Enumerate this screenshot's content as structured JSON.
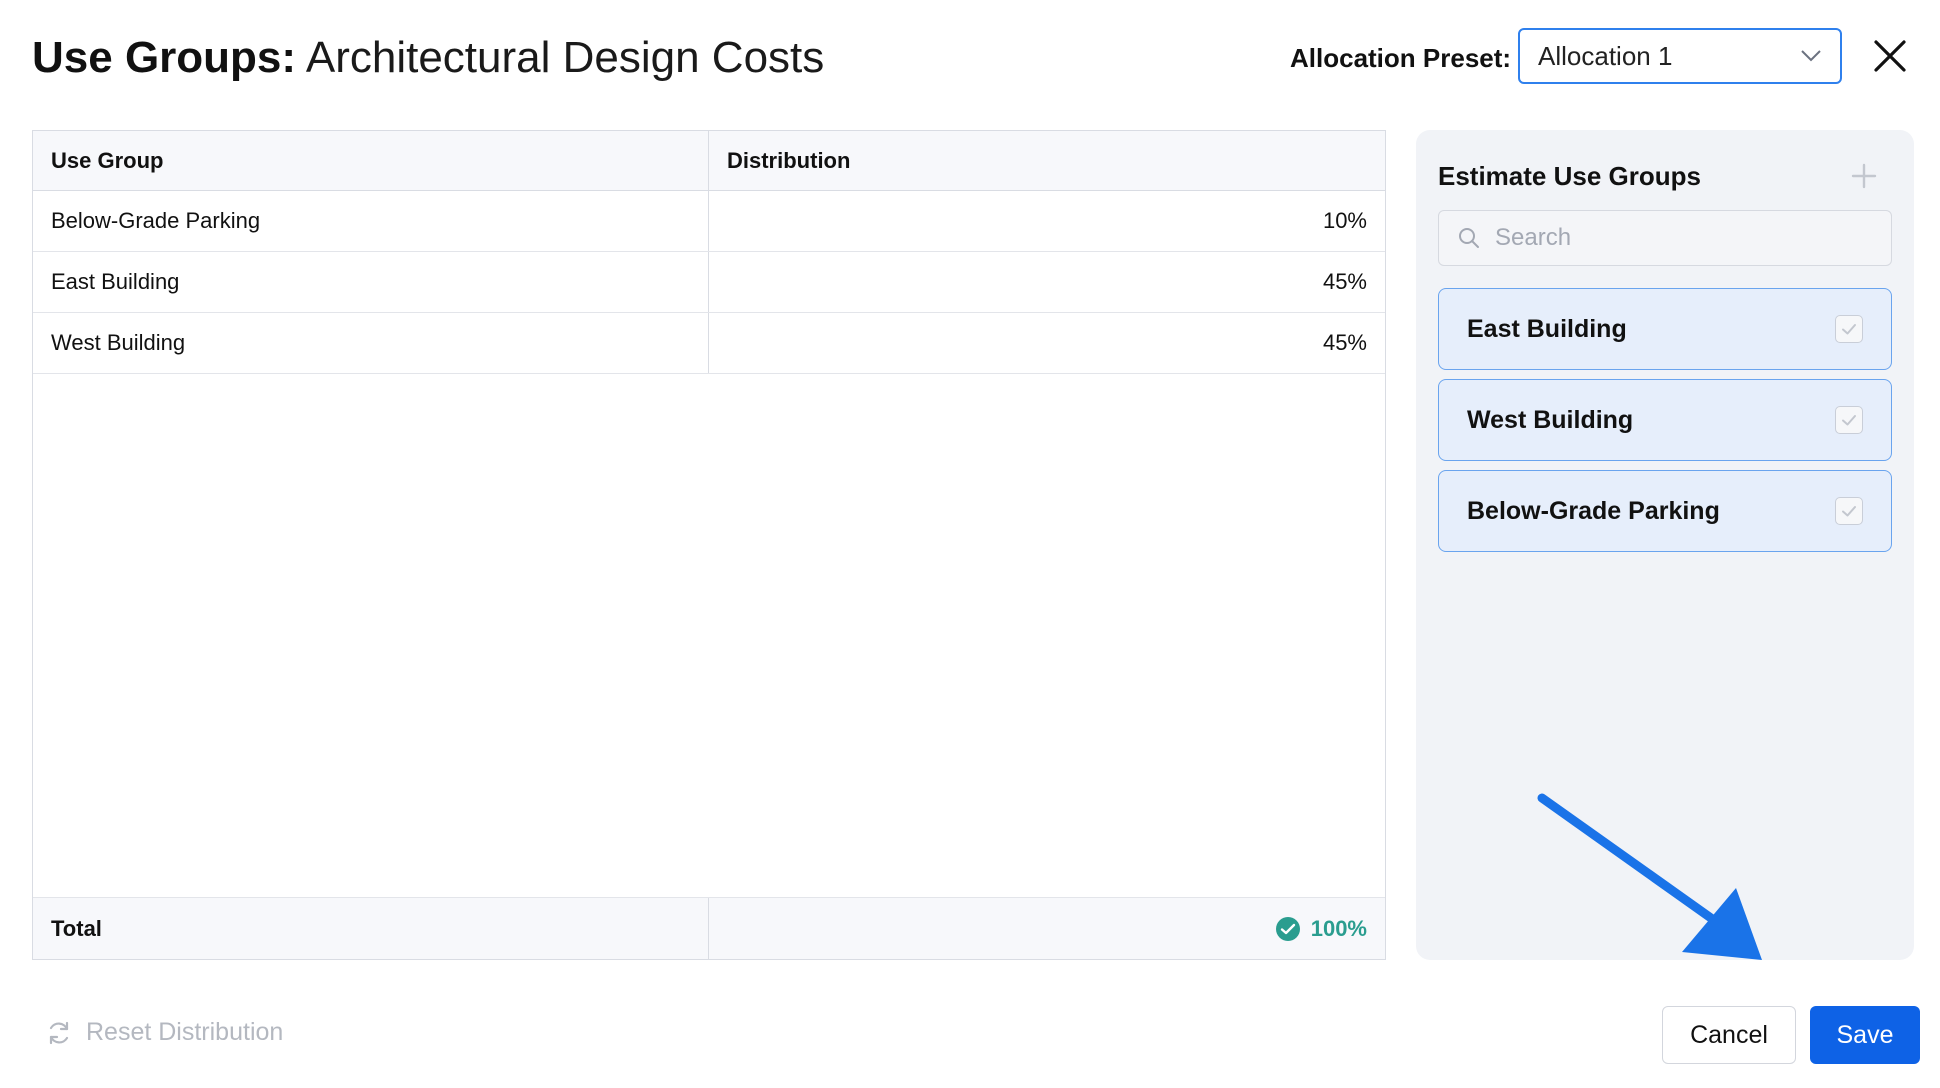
{
  "header": {
    "title_strong": "Use Groups:",
    "title_rest": "Architectural Design Costs",
    "preset_label": "Allocation Preset:",
    "preset_value": "Allocation 1"
  },
  "table": {
    "columns": [
      "Use Group",
      "Distribution"
    ],
    "rows": [
      {
        "group": "Below-Grade Parking",
        "distribution": "10%"
      },
      {
        "group": "East Building",
        "distribution": "45%"
      },
      {
        "group": "West Building",
        "distribution": "45%"
      }
    ],
    "total_label": "Total",
    "total_value": "100%"
  },
  "panel": {
    "title": "Estimate Use Groups",
    "search_placeholder": "Search",
    "groups": [
      {
        "label": "East Building",
        "checked": true
      },
      {
        "label": "West Building",
        "checked": true
      },
      {
        "label": "Below-Grade Parking",
        "checked": true
      }
    ]
  },
  "footer": {
    "reset_label": "Reset Distribution",
    "cancel_label": "Cancel",
    "save_label": "Save"
  },
  "colors": {
    "accent": "#0e62e6",
    "success": "#2a9d8f",
    "annotation_arrow": "#1a73e8"
  },
  "icons": [
    "chevron-down-icon",
    "close-icon",
    "plus-icon",
    "search-icon",
    "checkbox-check-icon",
    "check-circle-icon",
    "refresh-icon",
    "arrow-annotation-icon"
  ]
}
